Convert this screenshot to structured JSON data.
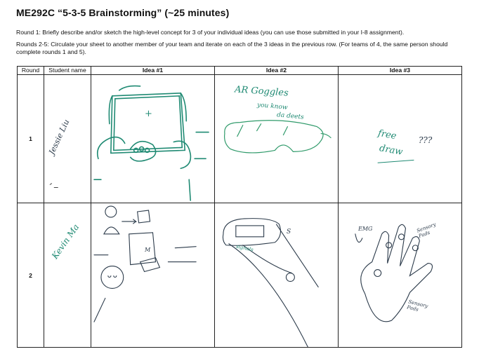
{
  "header": {
    "title": "ME292C “5-3-5 Brainstorming” (~25 minutes)",
    "round1": "Round 1: Briefly describe and/or sketch the high-level concept for 3 of your individual ideas (you can use those submitted in your I-8 assignment).",
    "rounds25": "Rounds 2-5: Circulate your sheet to another member of your team and iterate on each of the 3 ideas in the previous row. (For teams of 4, the same person should complete rounds 1 and 5)."
  },
  "table": {
    "columns": [
      "Round",
      "Student name",
      "Idea #1",
      "Idea #2",
      "Idea #3"
    ],
    "rows": [
      {
        "round": "1",
        "student_name": "Jessie Liu",
        "idea1_text": "+",
        "idea2_text": [
          "AR Goggles",
          "you know",
          "da deets"
        ],
        "idea3_text": [
          "free",
          "draw",
          "???"
        ]
      },
      {
        "round": "2",
        "student_name": "Kevin Ma",
        "idea1_text": "M",
        "idea2_text": [
          "S",
          "signals"
        ],
        "idea3_text": [
          "EMG",
          "Sensory Pads",
          "Sensory Pads"
        ]
      }
    ]
  },
  "colors": {
    "ink_teal": "#1f8a73",
    "ink_dark": "#2b3a4a",
    "ink_green": "#2f9a6a"
  }
}
